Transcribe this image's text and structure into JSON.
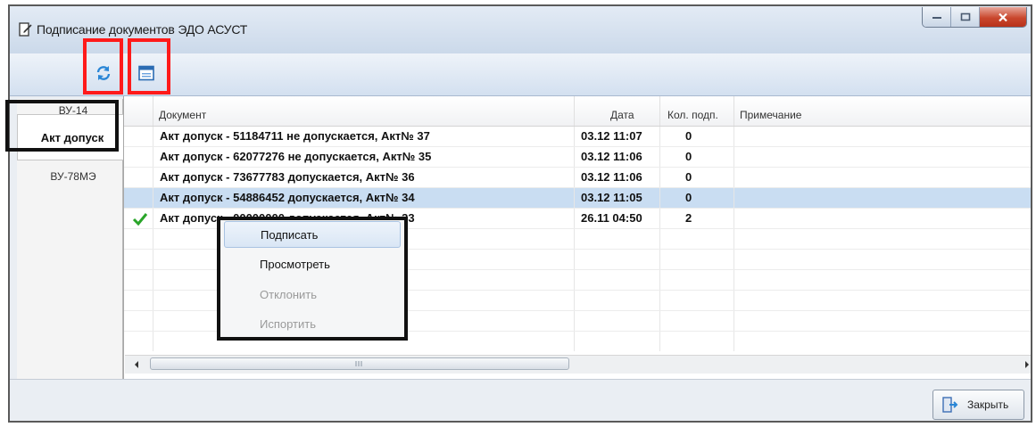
{
  "window": {
    "title": "Подписание документов ЭДО АСУСТ",
    "close_button_label": "Закрыть"
  },
  "toolbar": {
    "refresh_icon": "refresh-icon",
    "calendar_icon": "calendar-icon"
  },
  "tabs": [
    {
      "label": "ВУ-14"
    },
    {
      "label": "Акт допуск",
      "active": true
    },
    {
      "label": "ВУ-78МЭ"
    }
  ],
  "grid": {
    "headers": [
      "Документ",
      "Дата",
      "Кол. подп.",
      "Примечание"
    ],
    "rows": [
      {
        "document": "Акт допуск - 51184711 не допускается, Акт№ 37",
        "date": "03.12 11:07",
        "signatures": "0",
        "note": "",
        "signed": false
      },
      {
        "document": "Акт допуск - 62077276 не допускается, Акт№ 35",
        "date": "03.12 11:06",
        "signatures": "0",
        "note": "",
        "signed": false
      },
      {
        "document": "Акт допуск - 73677783  допускается, Акт№ 36",
        "date": "03.12 11:06",
        "signatures": "0",
        "note": "",
        "signed": false
      },
      {
        "document": "Акт допуск - 54886452  допускается, Акт№ 34",
        "date": "03.12 11:05",
        "signatures": "0",
        "note": "",
        "signed": false,
        "selected": true
      },
      {
        "document": "Акт допуск - 00000000  допускается, Акт№ 33",
        "date": "26.11 04:50",
        "signatures": "2",
        "note": "",
        "signed": true
      }
    ]
  },
  "context_menu": {
    "items": [
      {
        "label": "Подписать",
        "enabled": true,
        "hover": true
      },
      {
        "label": "Просмотреть",
        "enabled": true
      },
      {
        "label": "Отклонить",
        "enabled": false
      },
      {
        "label": "Испортить",
        "enabled": false
      }
    ]
  },
  "colors": {
    "highlight_red": "#ff1a1a",
    "highlight_black": "#111111",
    "selection": "#c9ddf2",
    "check_green": "#2aa52a"
  }
}
